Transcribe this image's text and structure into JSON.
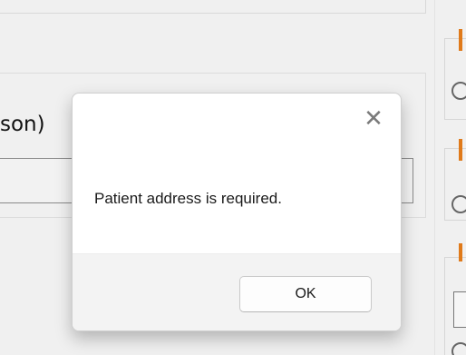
{
  "background": {
    "partial_label": "son)",
    "accent_color": "#e07a1a"
  },
  "dialog": {
    "close_icon": "close-icon",
    "close_glyph": "✕",
    "message": "Patient address is required.",
    "ok_label": "OK"
  }
}
